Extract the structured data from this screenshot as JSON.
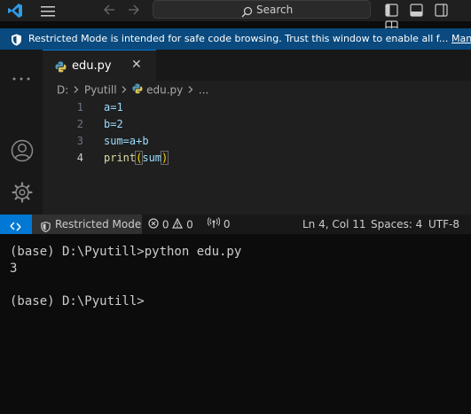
{
  "titlebar": {
    "search_label": "Search",
    "icons": [
      "vscode-logo",
      "menu-icon",
      "arrow-left-icon",
      "arrow-right-icon",
      "search-icon",
      "toggle-primary-sidebar-icon",
      "toggle-panel-icon",
      "toggle-secondary-sidebar-icon",
      "customize-layout-icon"
    ]
  },
  "banner": {
    "text": "Restricted Mode is intended for safe code browsing. Trust this window to enable all f...",
    "link": "Man"
  },
  "activity_bar": {
    "icons": [
      "more-icon",
      "account-icon",
      "gear-icon"
    ]
  },
  "editor": {
    "tab_label": "edu.py",
    "close_glyph": "✕",
    "breadcrumb": {
      "drive": "D:",
      "folder": "Pyutill",
      "file": "edu.py",
      "more": "..."
    },
    "lines": [
      {
        "num": "1",
        "text": "a=1"
      },
      {
        "num": "2",
        "text": "b=2"
      },
      {
        "num": "3",
        "text": "sum=a+b"
      },
      {
        "num": "4",
        "fn": "print",
        "open": "(",
        "arg": "sum",
        "close": ")"
      }
    ]
  },
  "statusbar": {
    "restricted_label": "Restricted Mode",
    "errors": "0",
    "warnings": "0",
    "ports": "0",
    "cursor": "Ln 4, Col 11",
    "spaces": "Spaces: 4",
    "encoding": "UTF-8"
  },
  "terminal": {
    "lines": [
      "(base) D:\\Pyutill>python edu.py",
      "3",
      "",
      "(base) D:\\Pyutill>"
    ]
  },
  "colors": {
    "accent": "#0078d4",
    "banner_bg": "#0a4a7e",
    "editor_bg": "#1f1f1f",
    "terminal_bg": "#0c0c0c",
    "variable": "#9cdcfe",
    "function": "#dcdcaa",
    "bracket": "#ffd700"
  }
}
